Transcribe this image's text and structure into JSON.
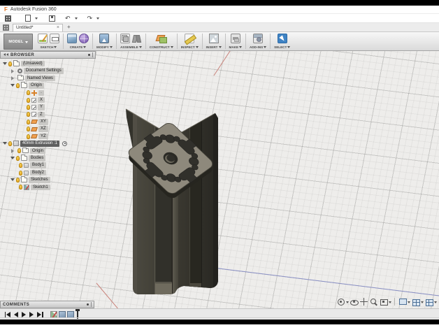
{
  "window": {
    "logo_letter": "F",
    "title": "Autodesk Fusion 360"
  },
  "quick_access": {
    "undo_glyph": "↶",
    "redo_glyph": "↷"
  },
  "tabs": {
    "active": "Untitled*",
    "close_glyph": "×",
    "new_tab_glyph": "+"
  },
  "ribbon": {
    "workspace": "MODEL",
    "groups": [
      "SKETCH",
      "CREATE",
      "MODIFY",
      "ASSEMBLE",
      "CONSTRUCT",
      "INSPECT",
      "INSERT",
      "MAKE",
      "ADD-INS",
      "SELECT"
    ]
  },
  "browser": {
    "header": "BROWSER",
    "items": [
      {
        "label": "(Unsaved)",
        "level": 0,
        "expanded": true
      },
      {
        "label": "Document Settings",
        "level": 1,
        "expanded": false
      },
      {
        "label": "Named Views",
        "level": 1,
        "expanded": false
      },
      {
        "label": "Origin",
        "level": 1,
        "expanded": true
      },
      {
        "label": "·",
        "level": 2
      },
      {
        "label": "X",
        "level": 2
      },
      {
        "label": "Y",
        "level": 2
      },
      {
        "label": "Z",
        "level": 2
      },
      {
        "label": "XY",
        "level": 2
      },
      {
        "label": "XZ",
        "level": 2
      },
      {
        "label": "YZ",
        "level": 2
      },
      {
        "label": "40mm Extrusion :1",
        "level": 0,
        "expanded": true,
        "selected": true
      },
      {
        "label": "Origin",
        "level": 1,
        "expanded": false
      },
      {
        "label": "Bodies",
        "level": 1,
        "expanded": true
      },
      {
        "label": "Body1",
        "level": 2
      },
      {
        "label": "Body2",
        "level": 2
      },
      {
        "label": "Sketches",
        "level": 1,
        "expanded": true
      },
      {
        "label": "Sketch1",
        "level": 2
      }
    ]
  },
  "comments": {
    "header": "COMMENTS"
  },
  "viewport": {
    "background": "#EEEDEB",
    "axis_x_color": "#c9837b",
    "axis_z_color": "#8a90c5",
    "model": {
      "name": "40mm aluminum t-slot extrusion",
      "top_face_color": "#8e897c",
      "body_color": "#34332c"
    }
  },
  "colors": {
    "select_accent": "#3f83c4",
    "selection_row": "#5f5f5f",
    "plane_orange": "#f0a050"
  }
}
